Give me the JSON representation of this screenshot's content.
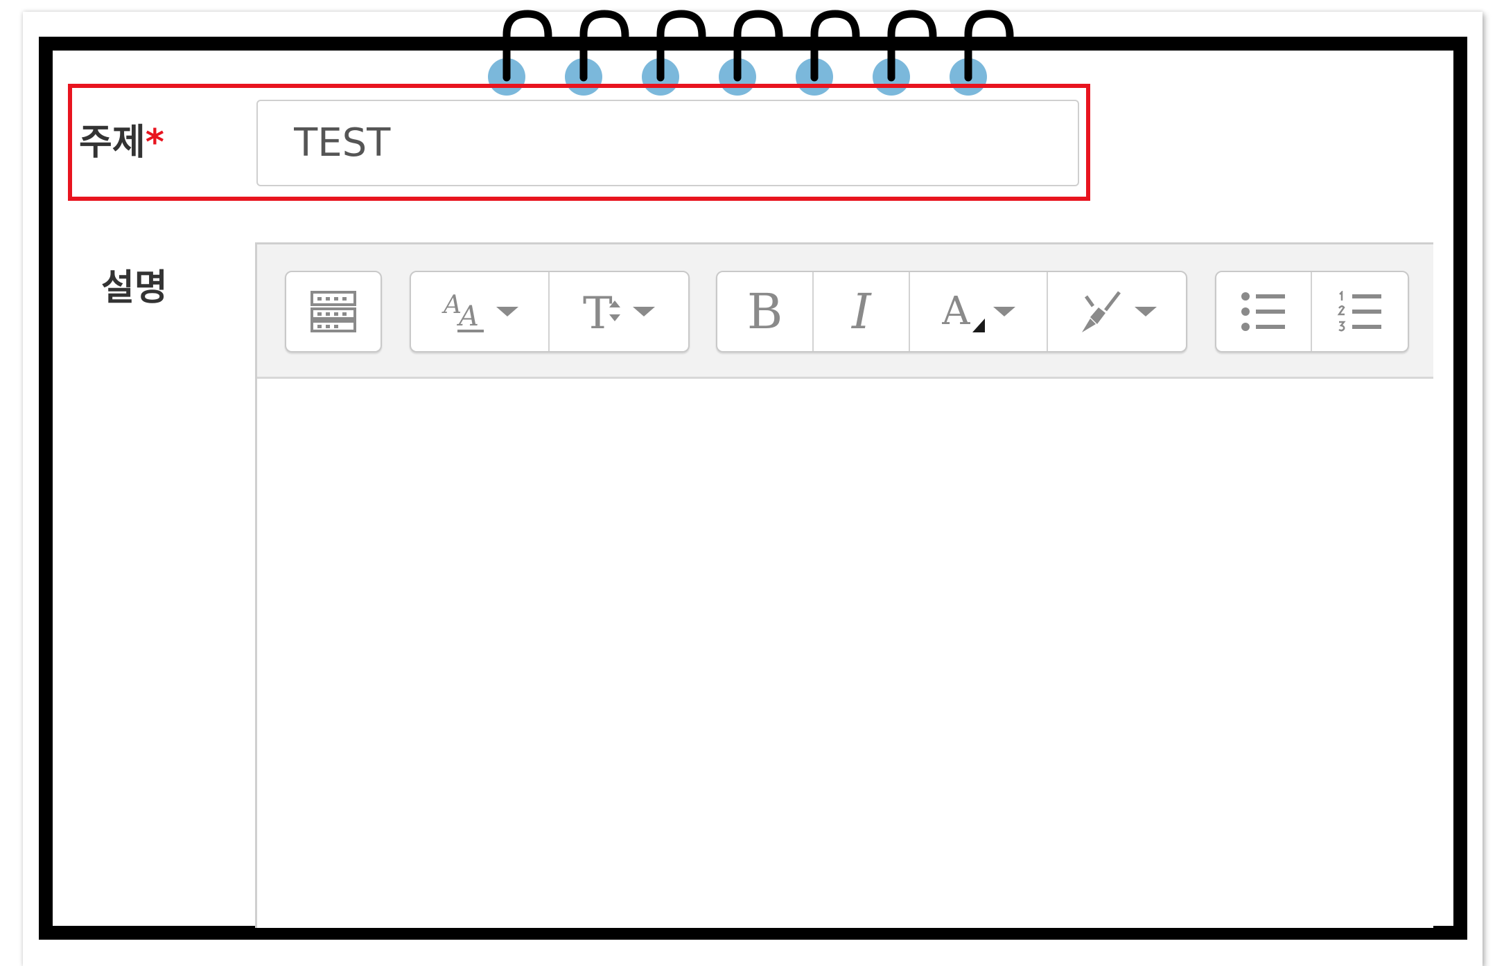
{
  "form": {
    "subject_label": "주제",
    "required_mark": "*",
    "subject_value": "TEST",
    "description_label": "설명"
  },
  "toolbar": {
    "groups": [
      {
        "buttons": [
          {
            "icon": "toolbar-toggle-icon"
          }
        ]
      },
      {
        "buttons": [
          {
            "icon": "paragraph-style-icon",
            "dropdown": true
          },
          {
            "icon": "font-size-icon",
            "dropdown": true
          }
        ]
      },
      {
        "buttons": [
          {
            "icon": "bold-icon",
            "glyph": "B"
          },
          {
            "icon": "italic-icon",
            "glyph": "I"
          },
          {
            "icon": "font-color-icon",
            "dropdown": true
          },
          {
            "icon": "highlight-icon",
            "dropdown": true
          }
        ]
      },
      {
        "buttons": [
          {
            "icon": "unordered-list-icon"
          },
          {
            "icon": "ordered-list-icon"
          }
        ]
      }
    ]
  },
  "colors": {
    "highlight_border": "#e8141f",
    "notebook_border": "#000000",
    "spiral_ring": "#7bb8db",
    "toolbar_bg": "#f2f2f2",
    "icon": "#8a8a8a"
  }
}
